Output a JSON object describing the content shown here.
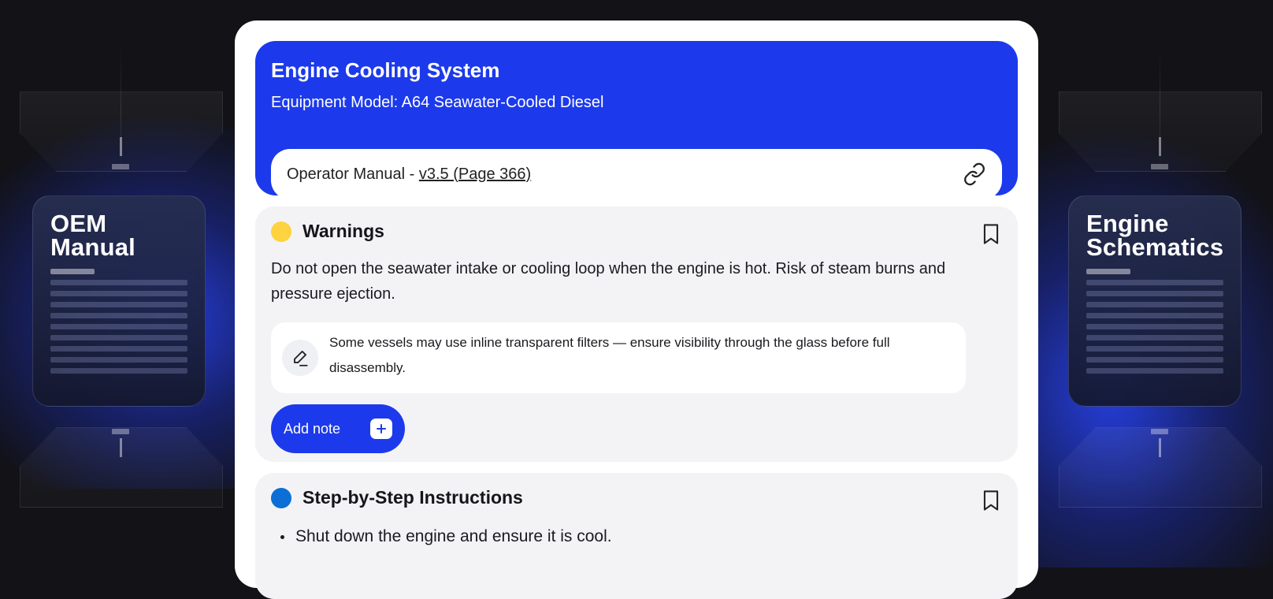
{
  "left_card": {
    "title": "OEM\nManual"
  },
  "right_card": {
    "title": "Engine\nSchematics"
  },
  "header": {
    "title": "Engine Cooling System",
    "subtitle": "Equipment Model: A64 Seawater-Cooled Diesel",
    "manual_prefix": "Operator Manual - ",
    "manual_link": "v3.5 (Page 366)",
    "link_icon": "link-icon"
  },
  "warnings": {
    "title": "Warnings",
    "dot_color": "#ffd23f",
    "text": "Do not open the seawater intake or cooling loop when the engine is hot. Risk of steam burns and pressure ejection.",
    "note": {
      "icon": "pen-icon",
      "text": "Some vessels may use inline transparent filters — ensure visibility through the glass before full disassembly."
    },
    "add_note_label": "Add note",
    "bookmark_icon": "bookmark-icon"
  },
  "steps": {
    "title": "Step-by-Step Instructions",
    "dot_color": "#0b6fd6",
    "items": [
      "Shut down the engine and ensure it is cool."
    ],
    "bookmark_icon": "bookmark-icon"
  },
  "colors": {
    "accent": "#1c3aeb",
    "background": "#121217",
    "panel": "#ffffff",
    "section": "#f3f3f6"
  }
}
